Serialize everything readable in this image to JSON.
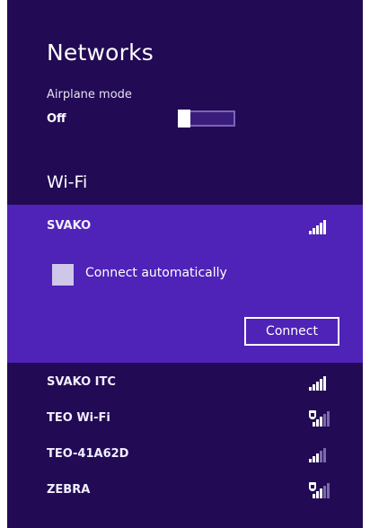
{
  "panel": {
    "title": "Networks",
    "airplane_mode": {
      "label": "Airplane mode",
      "state": "Off",
      "enabled": false
    },
    "wifi_section": {
      "title": "Wi-Fi"
    },
    "networks": [
      {
        "name": "SVAKO",
        "selected": true,
        "secured": false,
        "signal_level": 5,
        "signal_max": 5,
        "connect_automatically": {
          "label": "Connect automatically",
          "checked": false
        },
        "connect_button": "Connect"
      },
      {
        "name": "SVAKO ITC",
        "selected": false,
        "secured": false,
        "signal_level": 5,
        "signal_max": 5
      },
      {
        "name": "TEO Wi-Fi",
        "selected": false,
        "secured": true,
        "signal_level": 3,
        "signal_max": 5
      },
      {
        "name": "TEO-41A62D",
        "selected": false,
        "secured": false,
        "signal_level": 3,
        "signal_max": 5
      },
      {
        "name": "ZEBRA",
        "selected": false,
        "secured": true,
        "signal_level": 3,
        "signal_max": 5
      }
    ]
  },
  "colors": {
    "panel_background": "#220a55",
    "selected_background": "#4f22b8",
    "text": "#ffffff",
    "toggle_track": "#3a1c7a",
    "checkbox_fill": "#cfc7ea"
  },
  "icons": {
    "signal": "wifi-signal-icon",
    "secured_signal": "secured-wifi-signal-icon"
  }
}
